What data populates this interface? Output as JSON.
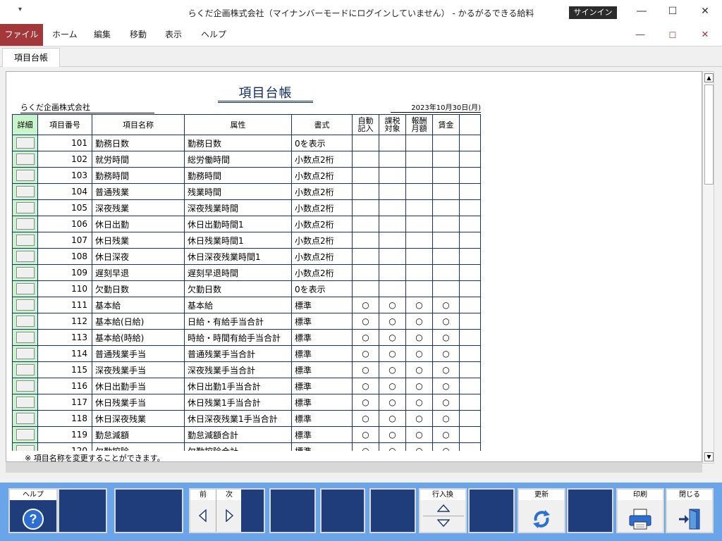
{
  "window": {
    "title": "らくだ企画株式会社（マイナンバーモードにログインしていません） - かるがるできる給料",
    "signin_label": "サインイン",
    "qa_glyph": "▾",
    "min_glyph": "―",
    "max_glyph": "☐",
    "close_glyph": "✕"
  },
  "menu": {
    "items": [
      "ファイル",
      "ホーム",
      "編集",
      "移動",
      "表示",
      "ヘルプ"
    ]
  },
  "tabs": {
    "items": [
      "項目台帳"
    ]
  },
  "report": {
    "title": "項目台帳",
    "company": "らくだ企画株式会社",
    "date": "2023年10月30日(月)",
    "note": "※ 項目名称を変更することができます。"
  },
  "grid": {
    "headers": {
      "detail": "詳細",
      "code": "項目番号",
      "name": "項目名称",
      "attr": "属性",
      "format": "書式",
      "auto1": "自動",
      "auto2": "記入",
      "tax1": "課税",
      "tax2": "対象",
      "pay1": "報酬",
      "pay2": "月額",
      "wage": "賃金"
    },
    "rows": [
      {
        "code": "101",
        "name": "勤務日数",
        "attr": "勤務日数",
        "format": "0を表示",
        "auto": "",
        "tax": "",
        "pay": "",
        "wage": ""
      },
      {
        "code": "102",
        "name": "就労時間",
        "attr": "総労働時間",
        "format": "小数点2桁",
        "auto": "",
        "tax": "",
        "pay": "",
        "wage": ""
      },
      {
        "code": "103",
        "name": "勤務時間",
        "attr": "勤務時間",
        "format": "小数点2桁",
        "auto": "",
        "tax": "",
        "pay": "",
        "wage": ""
      },
      {
        "code": "104",
        "name": "普通残業",
        "attr": "残業時間",
        "format": "小数点2桁",
        "auto": "",
        "tax": "",
        "pay": "",
        "wage": ""
      },
      {
        "code": "105",
        "name": "深夜残業",
        "attr": "深夜残業時間",
        "format": "小数点2桁",
        "auto": "",
        "tax": "",
        "pay": "",
        "wage": ""
      },
      {
        "code": "106",
        "name": "休日出勤",
        "attr": "休日出勤時間1",
        "format": "小数点2桁",
        "auto": "",
        "tax": "",
        "pay": "",
        "wage": ""
      },
      {
        "code": "107",
        "name": "休日残業",
        "attr": "休日残業時間1",
        "format": "小数点2桁",
        "auto": "",
        "tax": "",
        "pay": "",
        "wage": ""
      },
      {
        "code": "108",
        "name": "休日深夜",
        "attr": "休日深夜残業時間1",
        "format": "小数点2桁",
        "auto": "",
        "tax": "",
        "pay": "",
        "wage": ""
      },
      {
        "code": "109",
        "name": "遅刻早退",
        "attr": "遅刻早退時間",
        "format": "小数点2桁",
        "auto": "",
        "tax": "",
        "pay": "",
        "wage": ""
      },
      {
        "code": "110",
        "name": "欠勤日数",
        "attr": "欠勤日数",
        "format": "0を表示",
        "auto": "",
        "tax": "",
        "pay": "",
        "wage": ""
      },
      {
        "code": "111",
        "name": "基本給",
        "attr": "基本給",
        "format": "標準",
        "auto": "○",
        "tax": "○",
        "pay": "○",
        "wage": "○"
      },
      {
        "code": "112",
        "name": "基本給(日給)",
        "attr": "日給・有給手当合計",
        "format": "標準",
        "auto": "○",
        "tax": "○",
        "pay": "○",
        "wage": "○"
      },
      {
        "code": "113",
        "name": "基本給(時給)",
        "attr": "時給・時間有給手当合計",
        "format": "標準",
        "auto": "○",
        "tax": "○",
        "pay": "○",
        "wage": "○"
      },
      {
        "code": "114",
        "name": "普通残業手当",
        "attr": "普通残業手当合計",
        "format": "標準",
        "auto": "○",
        "tax": "○",
        "pay": "○",
        "wage": "○"
      },
      {
        "code": "115",
        "name": "深夜残業手当",
        "attr": "深夜残業手当合計",
        "format": "標準",
        "auto": "○",
        "tax": "○",
        "pay": "○",
        "wage": "○"
      },
      {
        "code": "116",
        "name": "休日出勤手当",
        "attr": "休日出勤1手当合計",
        "format": "標準",
        "auto": "○",
        "tax": "○",
        "pay": "○",
        "wage": "○"
      },
      {
        "code": "117",
        "name": "休日残業手当",
        "attr": "休日残業1手当合計",
        "format": "標準",
        "auto": "○",
        "tax": "○",
        "pay": "○",
        "wage": "○"
      },
      {
        "code": "118",
        "name": "休日深夜残業",
        "attr": "休日深夜残業1手当合計",
        "format": "標準",
        "auto": "○",
        "tax": "○",
        "pay": "○",
        "wage": "○"
      },
      {
        "code": "119",
        "name": "勤怠減額",
        "attr": "勤怠減額合計",
        "format": "標準",
        "auto": "○",
        "tax": "○",
        "pay": "○",
        "wage": "○"
      },
      {
        "code": "120",
        "name": "欠勤控除",
        "attr": "欠勤控除合計",
        "format": "標準",
        "auto": "○",
        "tax": "○",
        "pay": "○",
        "wage": "○"
      }
    ]
  },
  "fkeys": {
    "help": "ヘルプ",
    "prev": "前",
    "next": "次",
    "row_switch": "行入換",
    "refresh": "更新",
    "print": "印刷",
    "close": "閉じる"
  },
  "colors": {
    "accent": "#a4373a",
    "fkey_bar": "#6aa5ea",
    "fkey_bg": "#1f3d7a",
    "grid_line": "#16307a",
    "detail_col": "#c9f3c9"
  }
}
